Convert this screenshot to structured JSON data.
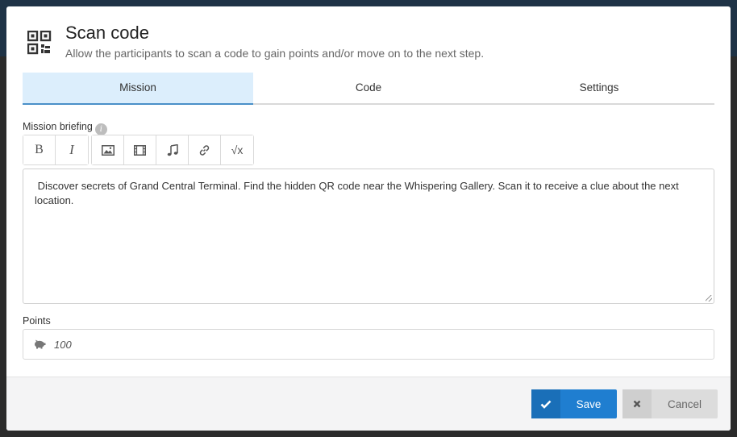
{
  "header": {
    "title": "Scan code",
    "subtitle": "Allow the participants to scan a code to gain points and/or move on to the next step.",
    "icon": "qr-code-icon"
  },
  "tabs": [
    {
      "label": "Mission",
      "active": true
    },
    {
      "label": "Code",
      "active": false
    },
    {
      "label": "Settings",
      "active": false
    }
  ],
  "mission": {
    "briefing_label": "Mission briefing",
    "info_icon": "info-icon",
    "toolbar": {
      "bold": "B",
      "italic": "I",
      "image_icon": "image-icon",
      "video_icon": "film-icon",
      "audio_icon": "music-icon",
      "link_icon": "link-icon",
      "formula_label": "√x"
    },
    "briefing_text": " Discover secrets of Grand Central Terminal. Find the hidden QR code near the Whispering Gallery. Scan it to receive a clue about the next location."
  },
  "points": {
    "label": "Points",
    "icon": "piggy-bank-icon",
    "value": "100"
  },
  "footer": {
    "save_label": "Save",
    "cancel_label": "Cancel"
  },
  "colors": {
    "accent": "#1f7ed0",
    "tab_active_bg": "#dceefc",
    "footer_bg": "#f4f4f5"
  }
}
